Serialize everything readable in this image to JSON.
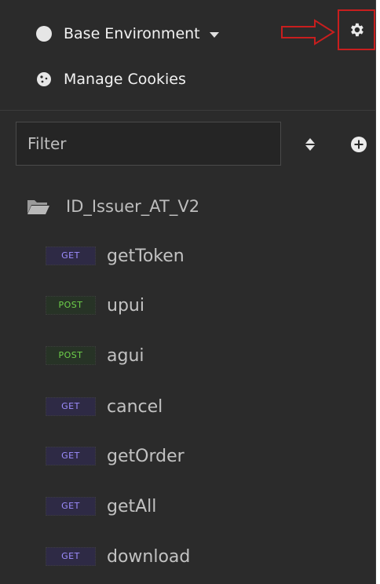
{
  "top": {
    "environment_label": "Base Environment",
    "cookies_label": "Manage Cookies"
  },
  "filter": {
    "placeholder": "Filter"
  },
  "folder": {
    "name": "ID_Issuer_AT_V2"
  },
  "requests": [
    {
      "method": "GET",
      "name": "getToken"
    },
    {
      "method": "POST",
      "name": "upui"
    },
    {
      "method": "POST",
      "name": "agui"
    },
    {
      "method": "GET",
      "name": "cancel"
    },
    {
      "method": "GET",
      "name": "getOrder"
    },
    {
      "method": "GET",
      "name": "getAll"
    },
    {
      "method": "GET",
      "name": "download"
    }
  ],
  "colors": {
    "get_method": "#9e8dff",
    "post_method": "#6ed14a",
    "annotation_red": "#c81e1e"
  }
}
